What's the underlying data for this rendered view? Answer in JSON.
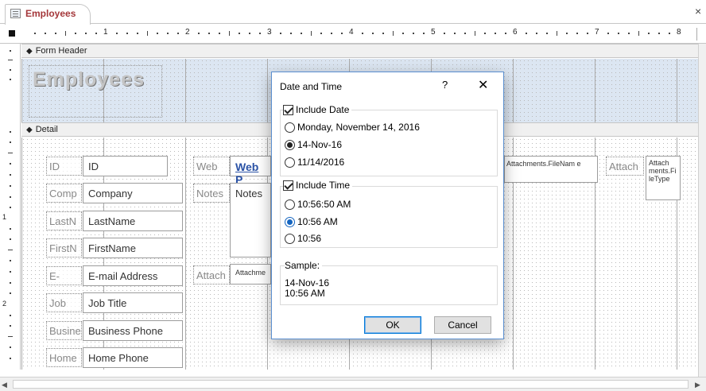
{
  "tab": {
    "label": "Employees",
    "close": "×"
  },
  "ruler": {
    "numbers": [
      "1",
      "2",
      "3",
      "4",
      "5",
      "6",
      "7",
      "8"
    ]
  },
  "vruler": {
    "numbers": [
      "1",
      "2"
    ]
  },
  "sections": {
    "header": "Form Header",
    "detail": "Detail"
  },
  "form_title": "Employees",
  "fields": {
    "id": {
      "label": "ID",
      "value": "ID"
    },
    "company": {
      "label": "Comp",
      "value": "Company"
    },
    "lastname": {
      "label": "LastN",
      "value": "LastName"
    },
    "firstname": {
      "label": "FirstN",
      "value": "FirstName"
    },
    "email": {
      "label": "E-",
      "value": "E-mail Address"
    },
    "jobtitle": {
      "label": "Job",
      "value": "Job Title"
    },
    "business": {
      "label": "Busine",
      "value": "Business Phone"
    },
    "home": {
      "label": "Home",
      "value": "Home Phone"
    },
    "web": {
      "label": "Web",
      "value": "Web P"
    },
    "notes": {
      "label": "Notes",
      "value": "Notes"
    },
    "attach": {
      "label": "Attach",
      "value": "Attachme"
    },
    "attach_filename": {
      "value": "Attachments.FileNam e"
    },
    "attach2": {
      "label": "Attach",
      "value": "Attach ments.Fi leType"
    }
  },
  "dialog": {
    "title": "Date and Time",
    "help": "?",
    "close": "✕",
    "include_date": {
      "label": "Include Date",
      "checked": true
    },
    "date_formats": [
      {
        "label": "Monday, November 14, 2016",
        "selected": false
      },
      {
        "label": "14-Nov-16",
        "selected": true
      },
      {
        "label": "11/14/2016",
        "selected": false
      }
    ],
    "include_time": {
      "label": "Include Time",
      "checked": true
    },
    "time_formats": [
      {
        "label": "10:56:50 AM",
        "selected": false
      },
      {
        "label": "10:56 AM",
        "selected": true
      },
      {
        "label": "10:56",
        "selected": false
      }
    ],
    "sample_label": "Sample:",
    "sample_date": "14-Nov-16",
    "sample_time": "10:56 AM",
    "ok": "OK",
    "cancel": "Cancel"
  },
  "scroll": {
    "left": "◀",
    "right": "▶"
  }
}
